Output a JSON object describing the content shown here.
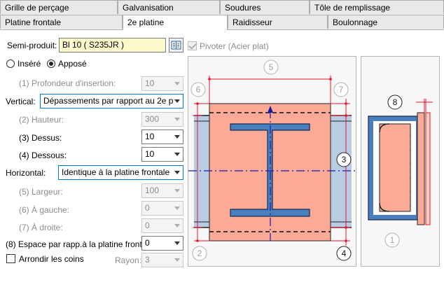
{
  "tabs_row1": [
    "Grille de perçage",
    "Galvanisation",
    "Soudures",
    "Tôle de remplissage"
  ],
  "tabs_row2": [
    "Platine frontale",
    "2e platine",
    "Raidisseur",
    "Boulonnage"
  ],
  "form": {
    "semi_produit_label": "Semi-produit:",
    "semi_produit_value": "Bl 10  ( S235JR )",
    "pivoter_label": "Pivoter (Acier plat)",
    "insere_label": "Inséré",
    "appose_label": "Apposé",
    "profondeur_label": "(1) Profondeur d'insertion:",
    "profondeur_value": "10",
    "vertical_label": "Vertical:",
    "vertical_value": "Dépassements par rapport au 2e p",
    "hauteur_label": "(2) Hauteur:",
    "hauteur_value": "300",
    "dessus_label": "(3) Dessus:",
    "dessus_value": "10",
    "dessous_label": "(4) Dessous:",
    "dessous_value": "10",
    "horizontal_label": "Horizontal:",
    "horizontal_value": "Identique à la platine frontale",
    "largeur_label": "(5) Largeur:",
    "largeur_value": "100",
    "gauche_label": "(6) À gauche:",
    "gauche_value": "0",
    "droite_label": "(7) À droite:",
    "droite_value": "0",
    "espace_label": "(8) Espace par rapp.à la platine front",
    "espace_value": "0",
    "arrondir_label": "Arrondir les coins",
    "rayon_label": "Rayon:",
    "rayon_value": "3"
  },
  "diagram": {
    "markers": [
      "1",
      "2",
      "3",
      "4",
      "5",
      "6",
      "7",
      "8"
    ],
    "colors": {
      "plate": "#fbaa98",
      "beam": "#4a7fbf",
      "web_ext": "#b8cce4",
      "dim_line": "#e8142b"
    }
  }
}
